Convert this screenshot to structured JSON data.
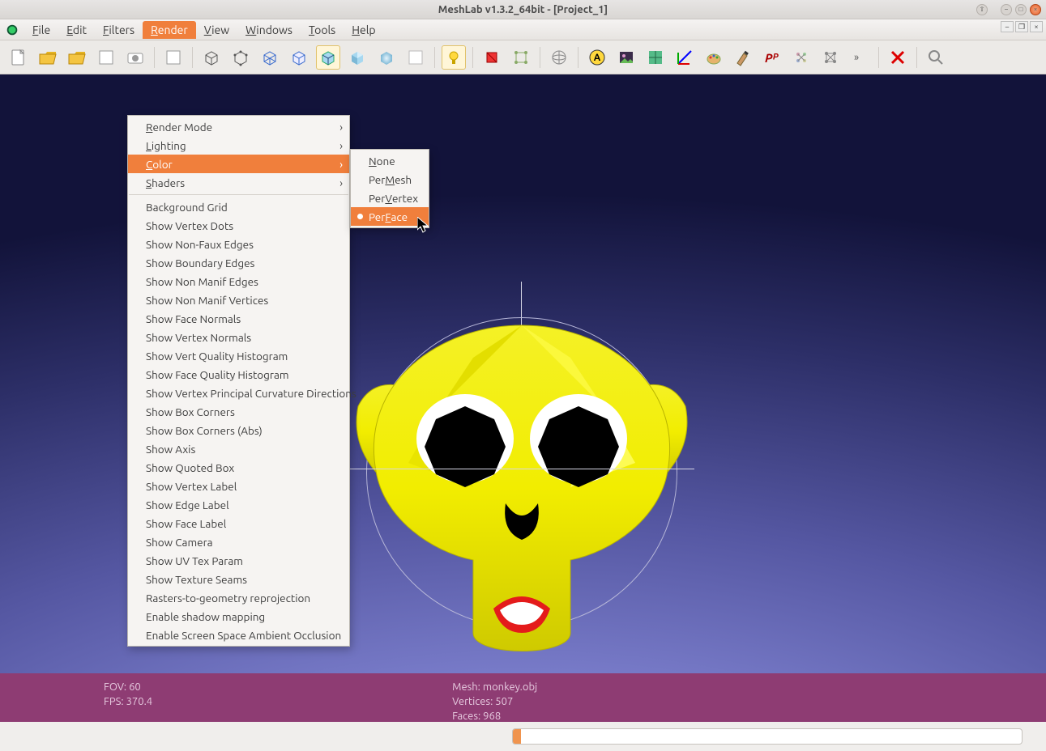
{
  "window": {
    "title": "MeshLab v1.3.2_64bit - [Project_1]"
  },
  "menubar": {
    "items": [
      "File",
      "Edit",
      "Filters",
      "Render",
      "View",
      "Windows",
      "Tools",
      "Help"
    ],
    "active": "Render"
  },
  "render_menu": {
    "top": [
      {
        "label": "Render Mode",
        "sub": true
      },
      {
        "label": "Lighting",
        "sub": true
      },
      {
        "label": "Color",
        "sub": true,
        "hl": true
      },
      {
        "label": "Shaders",
        "sub": true
      }
    ],
    "rest": [
      "Background Grid",
      "Show Vertex Dots",
      "Show Non-Faux Edges",
      "Show Boundary Edges",
      "Show Non Manif Edges",
      "Show Non Manif Vertices",
      "Show Face Normals",
      "Show Vertex Normals",
      "Show Vert Quality Histogram",
      "Show Face Quality Histogram",
      "Show Vertex Principal Curvature Directions",
      "Show Box Corners",
      "Show Box Corners (Abs)",
      "Show Axis",
      "Show Quoted Box",
      "Show Vertex Label",
      "Show Edge Label",
      "Show Face Label",
      "Show Camera",
      "Show UV Tex Param",
      "Show Texture Seams",
      "Rasters-to-geometry reprojection",
      "Enable shadow mapping",
      "Enable Screen Space Ambient Occlusion"
    ]
  },
  "color_menu": {
    "items": [
      {
        "label": "None"
      },
      {
        "label": "Per Mesh"
      },
      {
        "label": "Per Vertex"
      },
      {
        "label": "Per Face",
        "hl": true,
        "radio": true
      }
    ]
  },
  "status": {
    "fov": "FOV: 60",
    "fps": "FPS:   370.4",
    "mesh": "Mesh: monkey.obj",
    "verts": "Vertices: 507",
    "faces": "Faces: 968"
  },
  "toolbar_icons": [
    "new-project",
    "open-project",
    "open-mesh",
    "reload",
    "save-snapshot",
    "sep",
    "show-layers",
    "sep",
    "bbox-icon",
    "points-icon",
    "wire-icon",
    "hidden-line-icon",
    "flat-lines-icon",
    "flat-icon",
    "smooth-icon",
    "texture-icon",
    "sep",
    "light-icon",
    "sep",
    "selection-face-icon",
    "selection-vert-icon",
    "sep",
    "globe-icon",
    "sep",
    "annotation-icon",
    "image-icon",
    "texture-tool-icon",
    "axes-icon",
    "painter-icon",
    "brush-icon",
    "pp-icon",
    "cluster-icon",
    "graph-icon",
    "expand-icon",
    "sep",
    "delete-icon",
    "sep",
    "search-icon"
  ],
  "colors": {
    "accent": "#f07f3c",
    "status": "#8e3c73"
  }
}
